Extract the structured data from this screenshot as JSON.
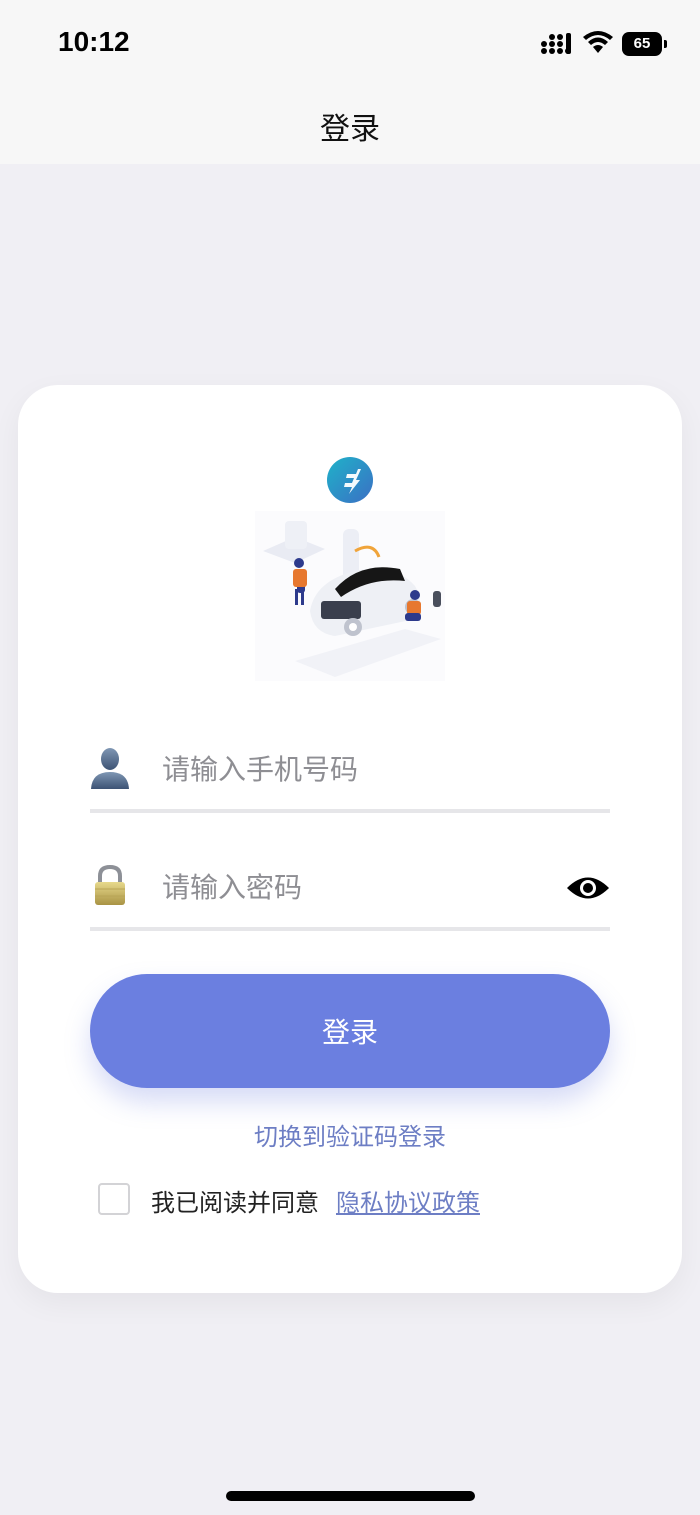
{
  "status_bar": {
    "time": "10:12",
    "battery_level": "65",
    "icons": [
      "signal-icon",
      "wifi-icon",
      "battery-icon"
    ]
  },
  "nav": {
    "title": "登录"
  },
  "form": {
    "phone_placeholder": "请输入手机号码",
    "password_placeholder": "请输入密码",
    "login_label": "登录",
    "switch_label": "切换到验证码登录",
    "agree_text": "我已阅读并同意",
    "privacy_link": "隐私协议政策"
  },
  "colors": {
    "accent": "#6b7fe0",
    "link": "#6d7ec4",
    "background": "#f0eff4"
  }
}
